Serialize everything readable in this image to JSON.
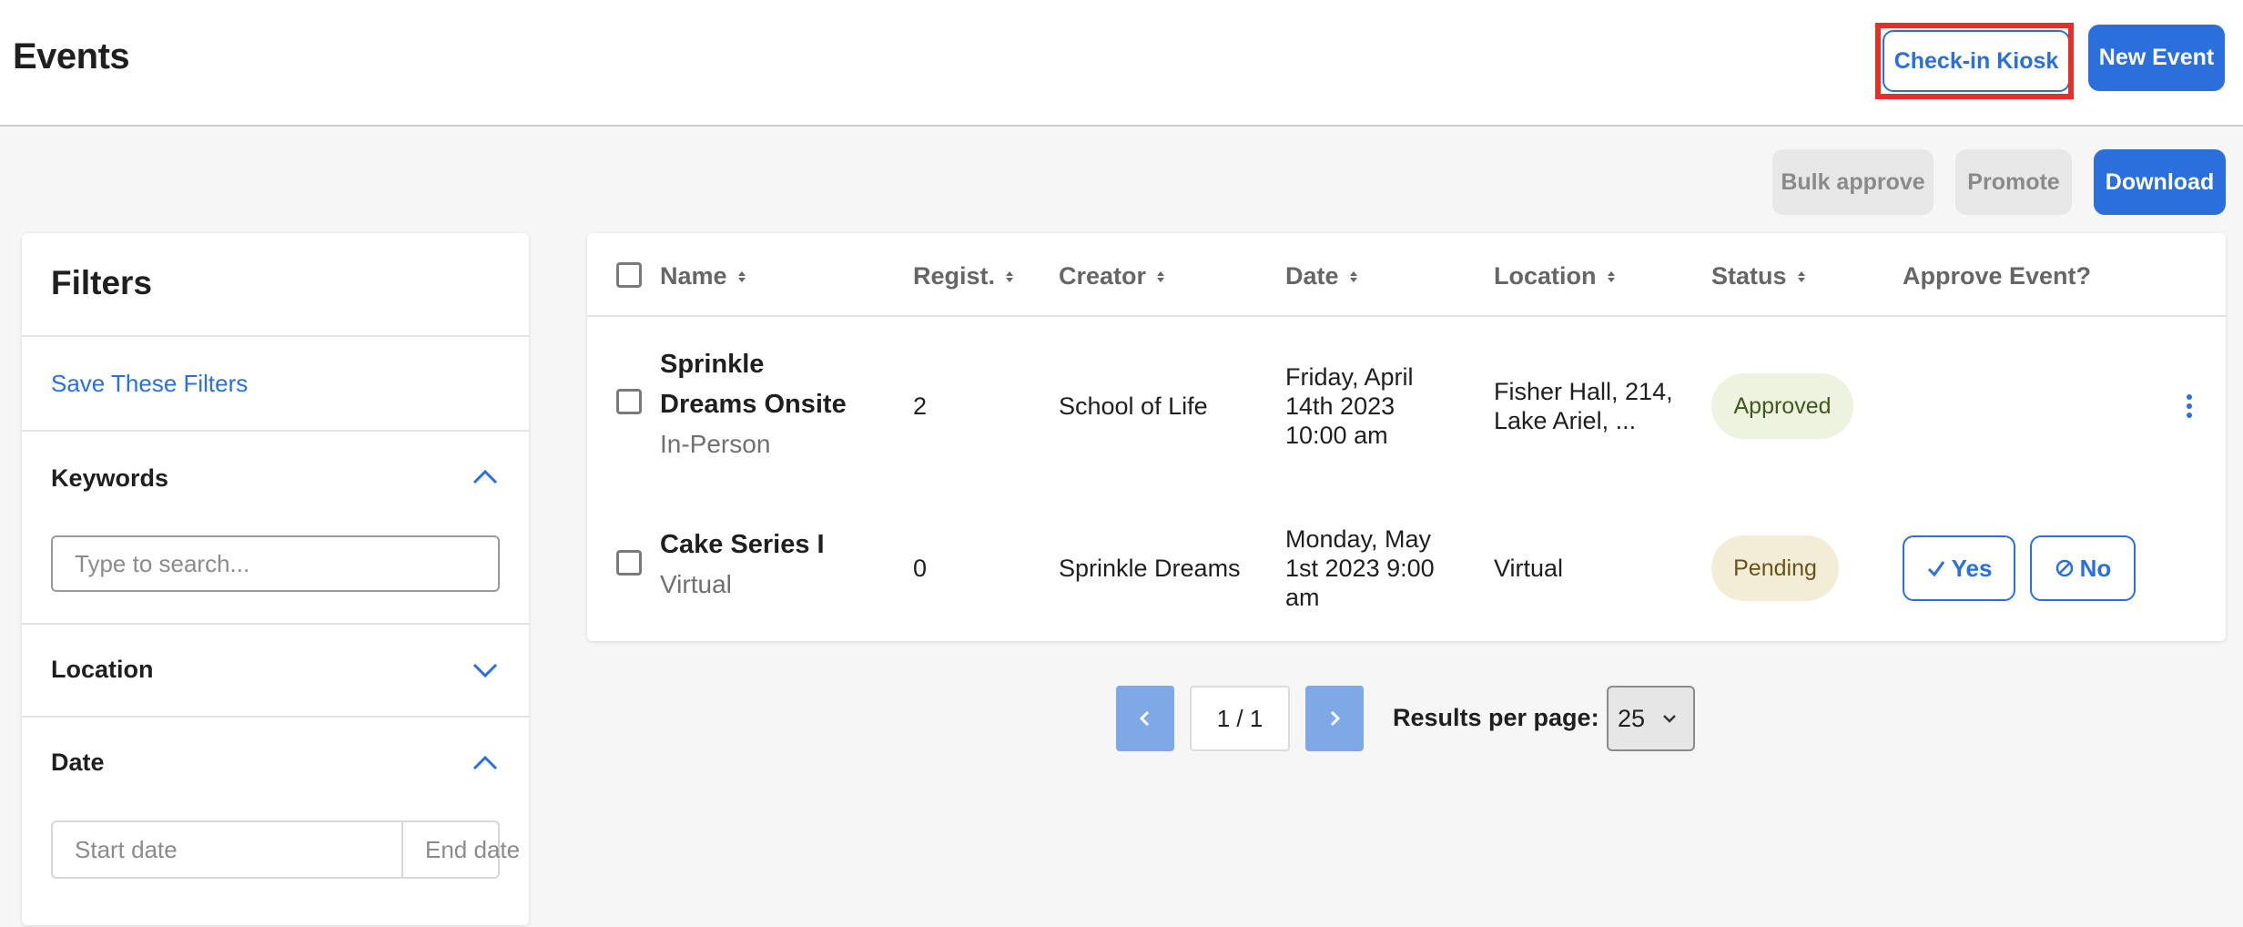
{
  "header": {
    "title": "Events",
    "checkin_label": "Check-in Kiosk",
    "new_event_label": "New Event"
  },
  "toolbar": {
    "bulk_approve_label": "Bulk approve",
    "promote_label": "Promote",
    "download_label": "Download"
  },
  "filters": {
    "title": "Filters",
    "save_label": "Save These Filters",
    "keywords_label": "Keywords",
    "keywords_placeholder": "Type to search...",
    "location_label": "Location",
    "date_label": "Date",
    "start_date_placeholder": "Start date",
    "end_date_placeholder": "End date"
  },
  "table": {
    "columns": {
      "name": "Name",
      "regist": "Regist.",
      "creator": "Creator",
      "date": "Date",
      "location": "Location",
      "status": "Status",
      "approve": "Approve Event?"
    },
    "rows": [
      {
        "name_line1": "Sprinkle",
        "name_line2": "Dreams Onsite",
        "type": "In-Person",
        "regist": "2",
        "creator": "School of Life",
        "date_line1": "Friday, April",
        "date_line2": "14th 2023",
        "date_line3": "10:00 am",
        "location_line1": "Fisher Hall, 214,",
        "location_line2": "Lake Ariel, ...",
        "status": "Approved"
      },
      {
        "name_line1": "Cake Series I",
        "type": "Virtual",
        "regist": "0",
        "creator": "Sprinkle Dreams",
        "date_line1": "Monday, May",
        "date_line2": "1st 2023 9:00",
        "date_line3": "am",
        "location_line1": "Virtual",
        "status": "Pending",
        "yes_label": "Yes",
        "no_label": "No"
      }
    ]
  },
  "pagination": {
    "page_indicator": "1 / 1",
    "results_per_page_label": "Results per page:",
    "results_per_page_value": "25"
  },
  "colors": {
    "accent": "#2a6fdb",
    "highlight": "#e5302a"
  }
}
